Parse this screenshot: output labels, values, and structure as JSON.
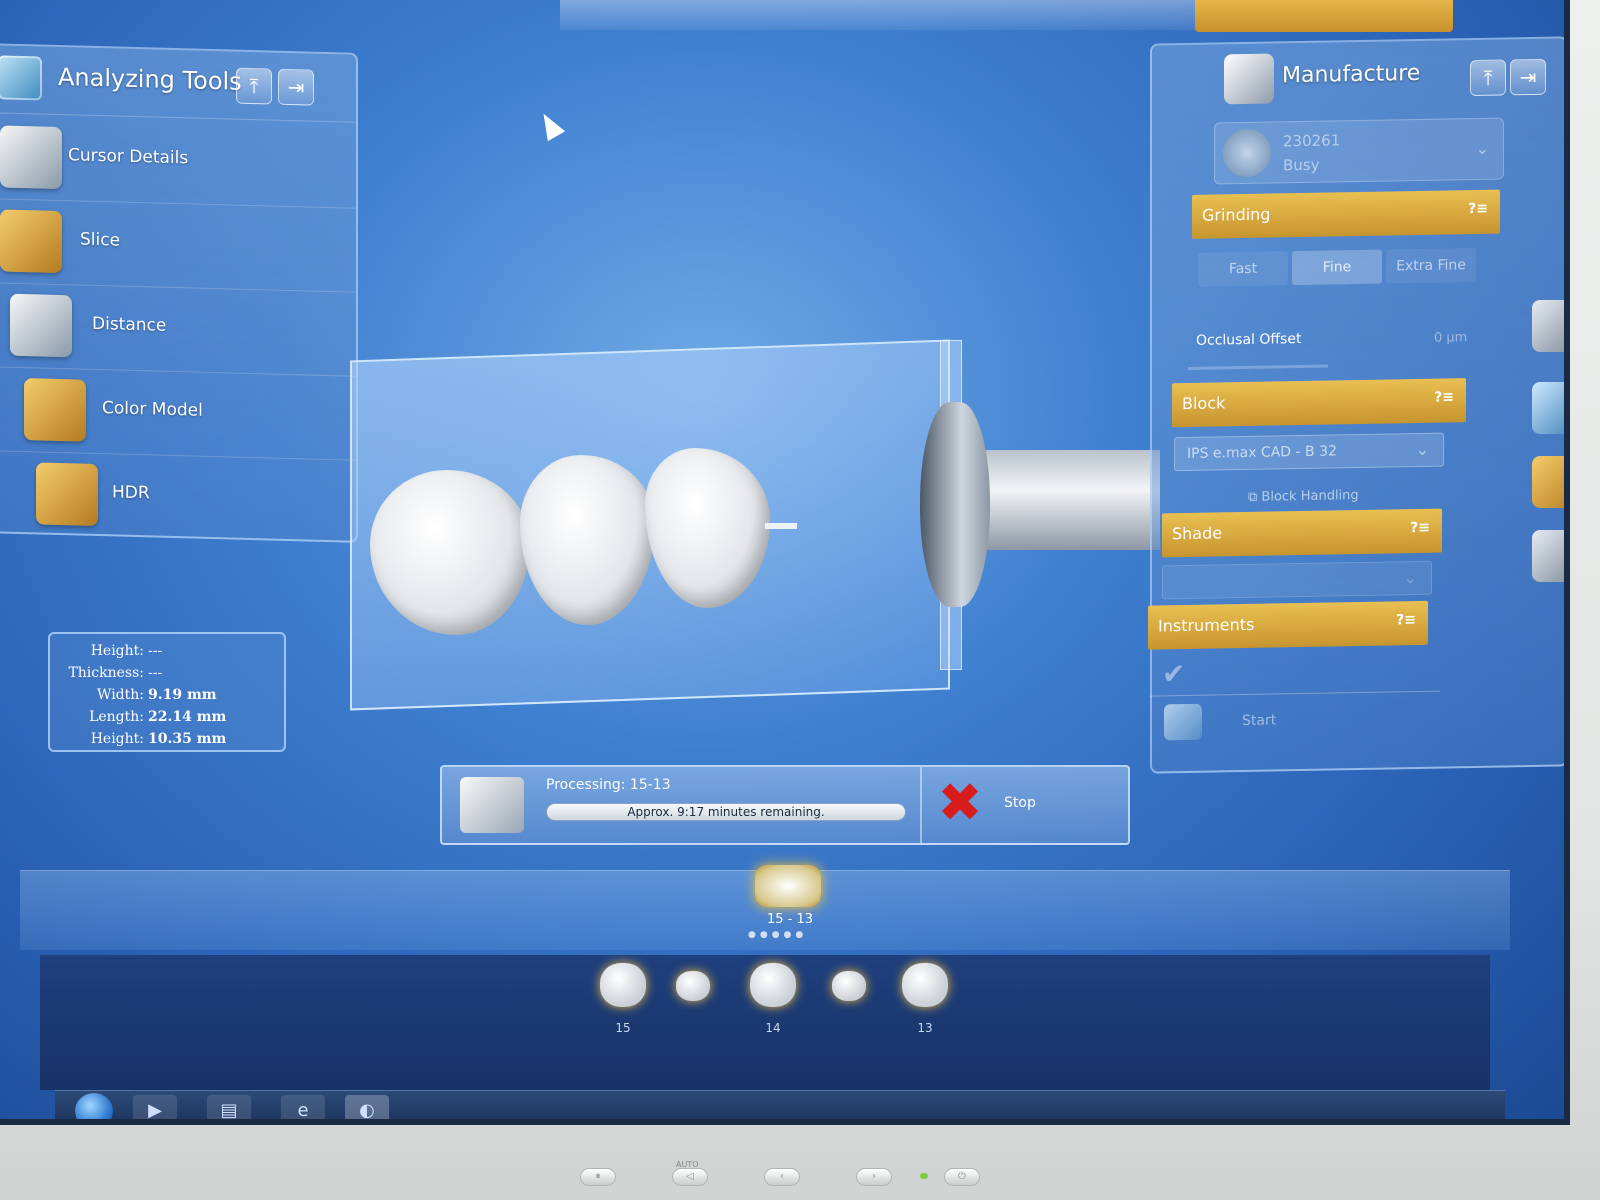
{
  "analyzing_tools": {
    "title": "Analyzing Tools",
    "items": [
      {
        "label": "Cursor Details"
      },
      {
        "label": "Slice"
      },
      {
        "label": "Distance"
      },
      {
        "label": "Color Model"
      },
      {
        "label": "HDR"
      }
    ]
  },
  "measurements": [
    {
      "label": "Height:",
      "value": "---"
    },
    {
      "label": "Thickness:",
      "value": "---"
    },
    {
      "label": "Width:",
      "value": "9.19 mm"
    },
    {
      "label": "Length:",
      "value": "22.14 mm"
    },
    {
      "label": "Height:",
      "value": "10.35 mm"
    }
  ],
  "processing": {
    "title": "Processing: 15-13",
    "remaining": "Approx. 9:17 minutes remaining.",
    "progress": 0.0,
    "stop_label": "Stop"
  },
  "restoration": {
    "label": "15 - 13"
  },
  "teeth_strip": [
    "15",
    "14",
    "13"
  ],
  "manufacture": {
    "title": "Manufacture",
    "device_id": "230261",
    "device_status": "Busy",
    "grinding": {
      "label": "Grinding",
      "modes": [
        "Fast",
        "Fine",
        "Extra Fine"
      ],
      "active_mode": "Fine"
    },
    "occlusal_offset": {
      "label": "Occlusal Offset",
      "value": "0 µm"
    },
    "block": {
      "label": "Block",
      "selected": "IPS e.max CAD - B 32",
      "handling": "Block Handling"
    },
    "shade": {
      "label": "Shade"
    },
    "instruments": {
      "label": "Instruments"
    },
    "start_label": "Start",
    "help_symbol": "?≡"
  },
  "bezel": {
    "auto_label": "AUTO"
  }
}
